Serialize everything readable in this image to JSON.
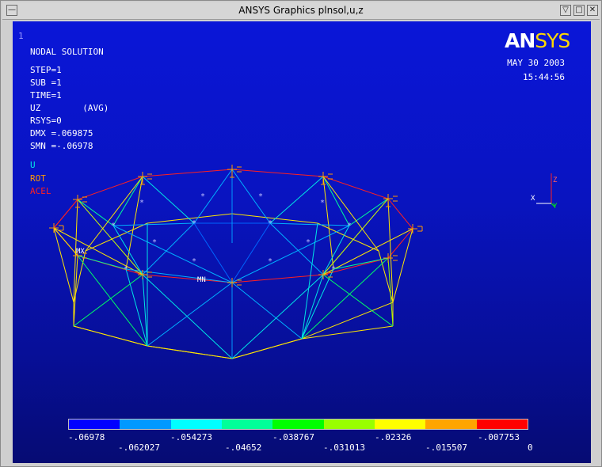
{
  "window": {
    "title": "ANSYS Graphics    plnsol,u,z",
    "sysmenu_icon": "dash-icon",
    "minimize_icon": "triangle-down-icon",
    "maximize_icon": "square-icon",
    "close_icon": "x-icon"
  },
  "plot": {
    "number": "1",
    "title": "NODAL SOLUTION",
    "info": [
      "STEP=1",
      "SUB =1",
      "TIME=1",
      "UZ        (AVG)",
      "RSYS=0",
      "DMX =.069875",
      "SMN =-.06978"
    ],
    "legend": [
      {
        "label": "U",
        "color": "#00e5e5"
      },
      {
        "label": "ROT",
        "color": "#ff9900"
      },
      {
        "label": "ACEL",
        "color": "#ff2020"
      }
    ],
    "logo_an": "AN",
    "logo_sys": "SYS",
    "date": "MAY 30 2003",
    "time": "15:44:56",
    "mn_label": "MN",
    "mx_label": "MX",
    "axis": {
      "x": "X",
      "y": "Y",
      "z": "Z"
    }
  },
  "contour": {
    "colors": [
      "#0000ff",
      "#0099ff",
      "#00ffff",
      "#00ff99",
      "#00ff00",
      "#99ff00",
      "#ffff00",
      "#ffa500",
      "#ff0000"
    ],
    "ticks_top": [
      "-.06978",
      "-.054273",
      "-.038767",
      "-.02326",
      "-.007753"
    ],
    "ticks_bottom": [
      "-.062027",
      "-.04652",
      "-.031013",
      "-.015507",
      "0"
    ]
  }
}
